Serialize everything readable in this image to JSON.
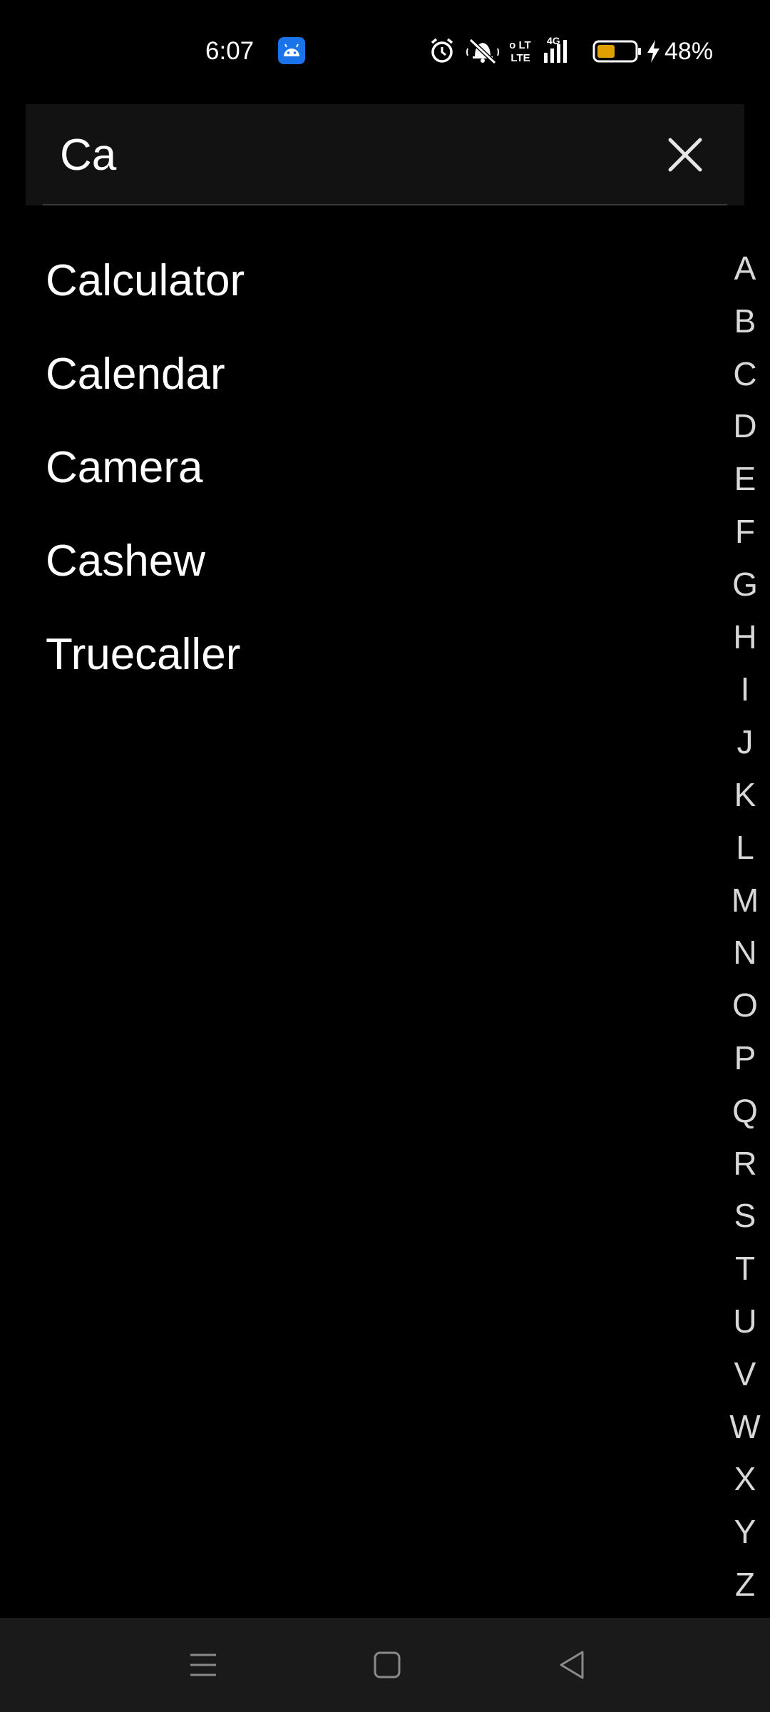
{
  "status_bar": {
    "time": "6:07",
    "icons": [
      "android-app-icon",
      "alarm-icon",
      "silent-bell-icon",
      "volte-icon",
      "4g-signal-icon",
      "battery-icon",
      "charging-icon"
    ],
    "volte_label": "Vo LTE",
    "network_label": "4G",
    "battery_percent": "48%",
    "battery_level": 0.48,
    "battery_color": "#e0a100",
    "app_badge_color": "#1a73e8"
  },
  "search": {
    "query": "Ca",
    "clear_icon": "close-icon"
  },
  "results": [
    {
      "label": "Calculator"
    },
    {
      "label": "Calendar"
    },
    {
      "label": "Camera"
    },
    {
      "label": "Cashew"
    },
    {
      "label": "Truecaller"
    }
  ],
  "alphabet_index": [
    "A",
    "B",
    "C",
    "D",
    "E",
    "F",
    "G",
    "H",
    "I",
    "J",
    "K",
    "L",
    "M",
    "N",
    "O",
    "P",
    "Q",
    "R",
    "S",
    "T",
    "U",
    "V",
    "W",
    "X",
    "Y",
    "Z"
  ],
  "nav_bar": {
    "buttons": [
      "menu-icon",
      "home-icon",
      "back-icon"
    ]
  }
}
